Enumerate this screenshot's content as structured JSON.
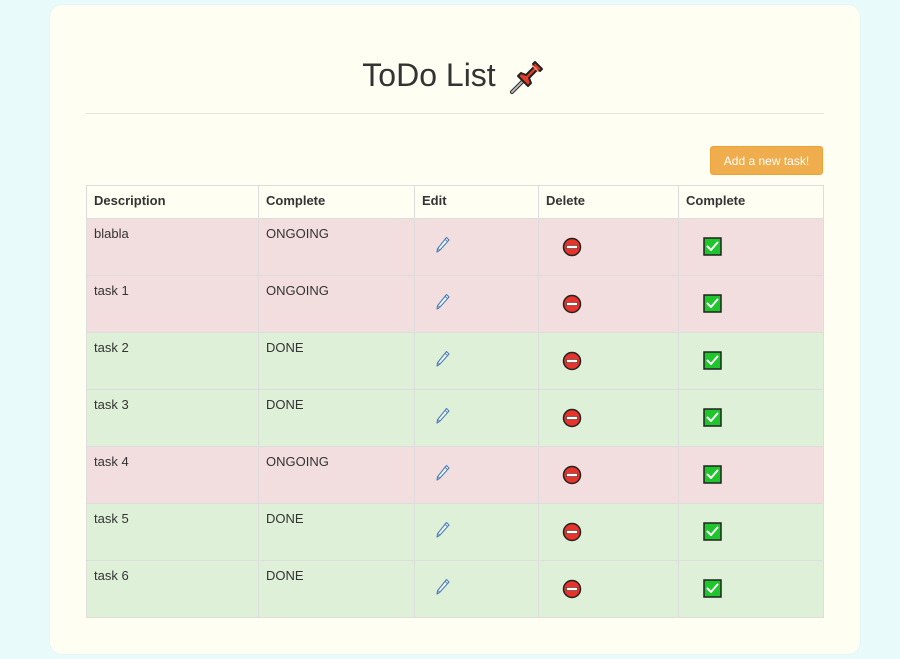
{
  "page": {
    "title": "ToDo List",
    "title_icon": "pushpin-icon"
  },
  "toolbar": {
    "add_label": "Add a new task!"
  },
  "table": {
    "headers": [
      "Description",
      "Complete",
      "Edit",
      "Delete",
      "Complete"
    ],
    "rows": [
      {
        "description": "blabla",
        "status": "ONGOING"
      },
      {
        "description": "task 1",
        "status": "ONGOING"
      },
      {
        "description": "task 2",
        "status": "DONE"
      },
      {
        "description": "task 3",
        "status": "DONE"
      },
      {
        "description": "task 4",
        "status": "ONGOING"
      },
      {
        "description": "task 5",
        "status": "DONE"
      },
      {
        "description": "task 6",
        "status": "DONE"
      }
    ]
  },
  "icons": {
    "edit": "pencil-icon",
    "delete": "no-entry-icon",
    "complete": "check-box-icon"
  },
  "colors": {
    "ongoing_row": "#f2dede",
    "done_row": "#dff0d8",
    "add_button": "#f0ad4e",
    "card_background": "#fefef2",
    "page_background": "#e9fafb"
  }
}
